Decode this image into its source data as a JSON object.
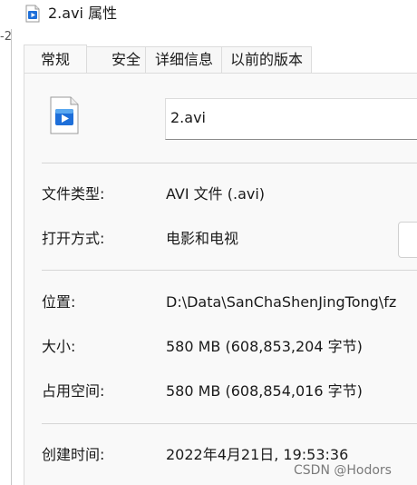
{
  "window": {
    "title": "2.avi 属性",
    "left_fragment": "-2"
  },
  "tabs": [
    {
      "label": "常规",
      "active": true
    },
    {
      "label": "安全",
      "active": false
    },
    {
      "label": "详细信息",
      "active": false
    },
    {
      "label": "以前的版本",
      "active": false
    }
  ],
  "general": {
    "file_name": "2.avi",
    "file_icon": "video-file-icon",
    "file_type_label": "文件类型:",
    "file_type_value": "AVI 文件 (.avi)",
    "open_with_label": "打开方式:",
    "open_with_value": "电影和电视",
    "location_label": "位置:",
    "location_value": "D:\\Data\\SanChaShenJingTong\\fz",
    "size_label": "大小:",
    "size_value": "580 MB (608,853,204 字节)",
    "size_on_disk_label": "占用空间:",
    "size_on_disk_value": "580 MB (608,854,016 字节)",
    "created_label": "创建时间:",
    "created_value": "2022年4月21日, 19:53:36"
  },
  "watermark": "CSDN @Hodors",
  "colors": {
    "icon_blue": "#1e6fd9",
    "icon_light": "#5aa8f0",
    "panel_bg": "#f9f9f9"
  }
}
